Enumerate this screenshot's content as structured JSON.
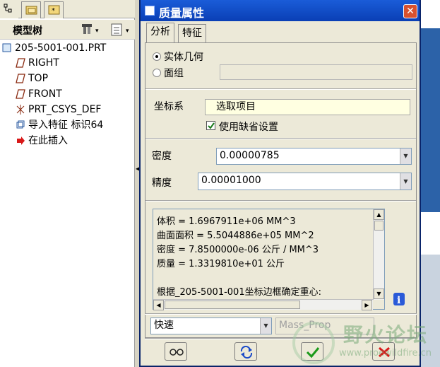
{
  "tree": {
    "title": "模型树",
    "items": [
      {
        "label": "205-5001-001.PRT",
        "icon": "part-icon"
      },
      {
        "label": "RIGHT",
        "icon": "datum-plane-icon"
      },
      {
        "label": "TOP",
        "icon": "datum-plane-icon"
      },
      {
        "label": "FRONT",
        "icon": "datum-plane-icon"
      },
      {
        "label": "PRT_CSYS_DEF",
        "icon": "coordinate-system-icon"
      },
      {
        "label": "导入特征 标识64",
        "icon": "import-feature-icon"
      },
      {
        "label": "在此插入",
        "icon": "insert-here-arrow-icon"
      }
    ]
  },
  "dialog": {
    "title": "质量属性",
    "close": "✕",
    "tabs": [
      {
        "label": "分析"
      },
      {
        "label": "特征"
      }
    ],
    "geometry": {
      "solid_label": "实体几何",
      "quilt_label": "面组",
      "selected": "solid"
    },
    "csys": {
      "label": "坐标系",
      "select_value": "选取项目",
      "use_default_label": "使用缺省设置",
      "use_default_checked": true
    },
    "density": {
      "label": "密度",
      "value": "0.00000785"
    },
    "precision": {
      "label": "精度",
      "value": "0.00001000"
    },
    "results": [
      "体积 =  1.6967911e+06  MM^3",
      "曲面面积 =  5.5044886e+05  MM^2",
      "密度 =  7.8500000e-06 公斤 / MM^3",
      "质量 =  1.3319810e+01 公斤",
      "",
      "根据_205-5001-001坐标边框确定重心:"
    ],
    "mode": {
      "value": "快速"
    },
    "param_placeholder": "Mass_Prop",
    "buttons": [
      "glasses-icon",
      "repeat-icon",
      "ok-check-icon",
      "cancel-x-icon"
    ]
  },
  "watermark": {
    "text": "野火论坛",
    "url": "www.proewildfire.cn"
  },
  "colors": {
    "titlebar": "#0a3fb5",
    "dialog_bg": "#ece9d8",
    "field_highlight": "#ffffe1"
  }
}
